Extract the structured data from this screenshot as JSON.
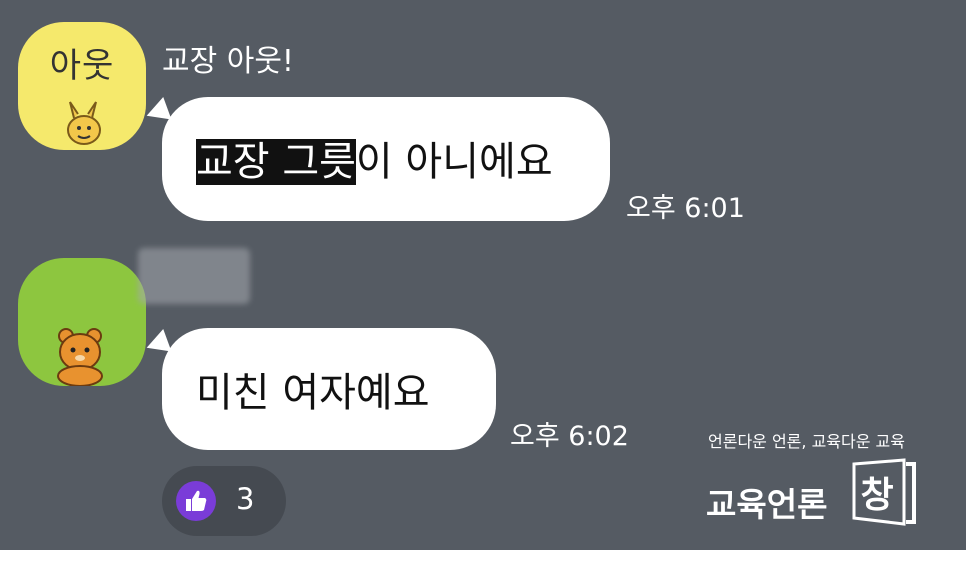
{
  "chat": {
    "messages": [
      {
        "sender": "교장 아웃!",
        "avatar_text": "아웃",
        "text_highlighted": "교장 그릇",
        "text_rest": "이 아니에요",
        "time": "오후 6:01"
      },
      {
        "text": "미친 여자예요",
        "time": "오후 6:02",
        "reaction": {
          "icon": "thumbs-up-icon",
          "count": "3"
        }
      }
    ]
  },
  "watermark": {
    "tagline": "언론다운 언론, 교육다운 교육",
    "name": "교육언론",
    "logo": "창"
  },
  "colors": {
    "chat_background": "#555b63",
    "bubble": "#ffffff",
    "avatar_1": "#f5e96c",
    "avatar_2": "#8dc63f",
    "reaction_accent": "#7a3cd8"
  }
}
